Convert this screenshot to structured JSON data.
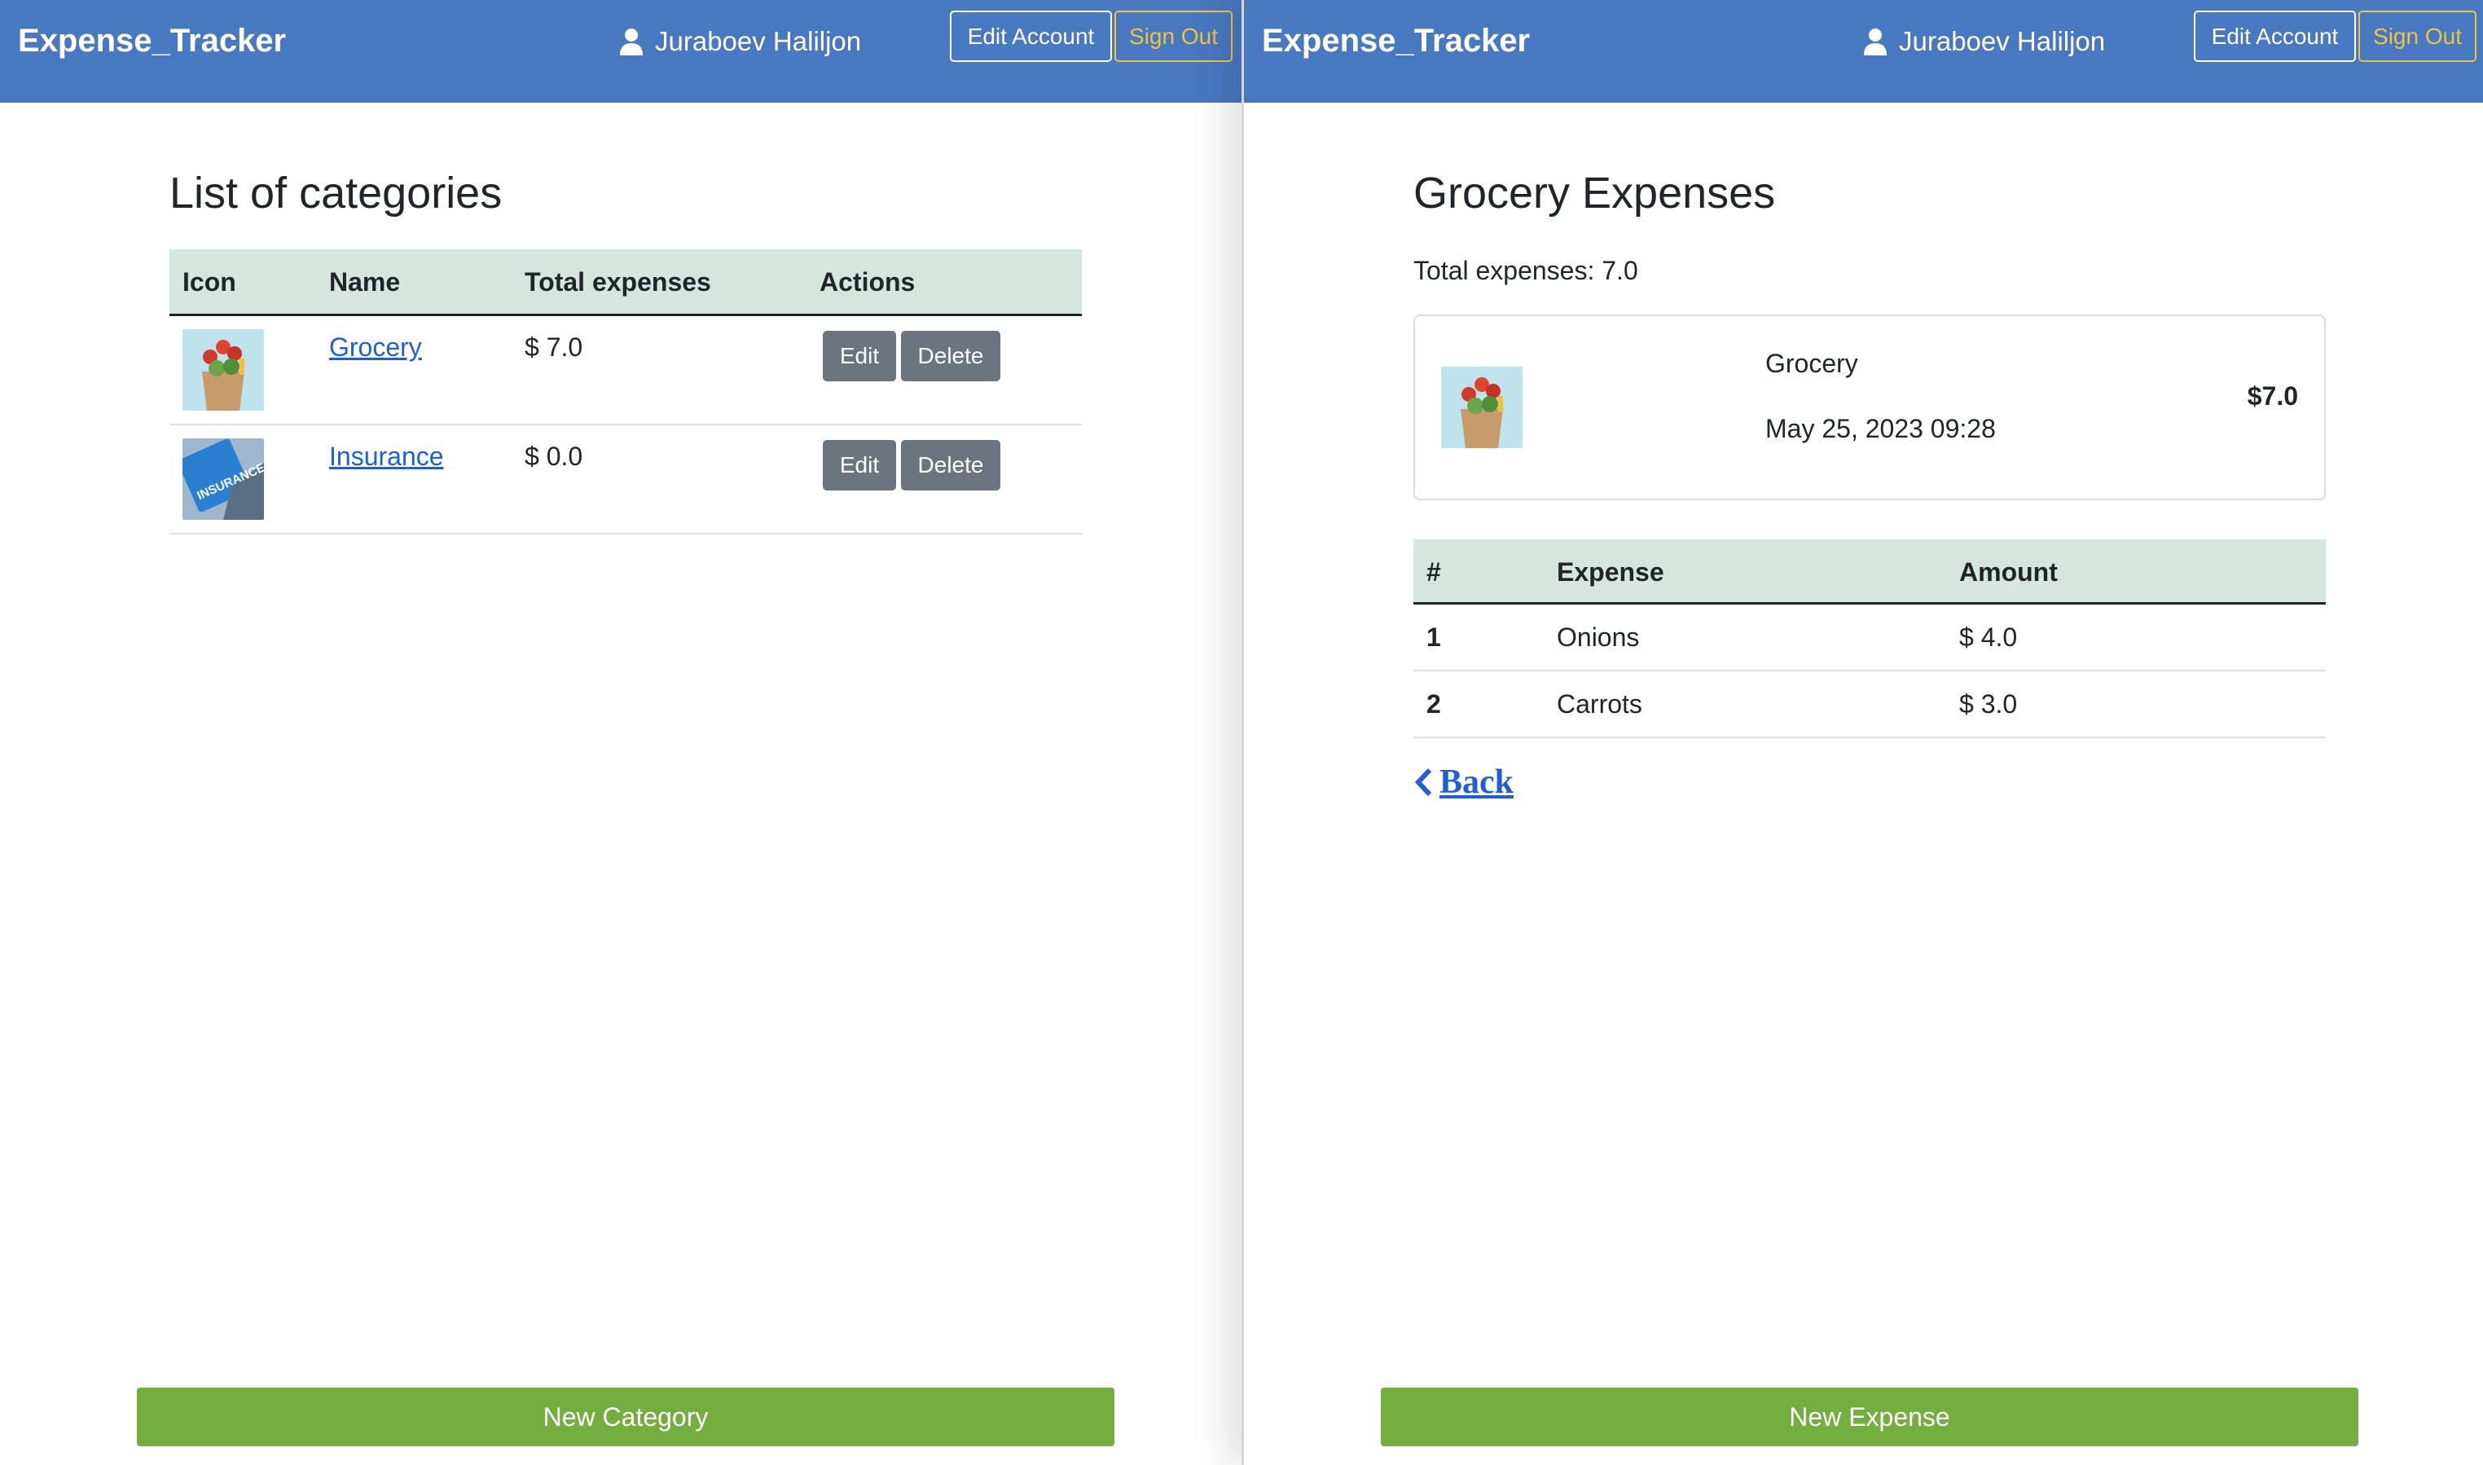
{
  "panels": [
    {
      "nav": {
        "brand": "Expense_Tracker",
        "user": "Juraboev Haliljon",
        "edit_account": "Edit Account",
        "sign_out": "Sign Out"
      }
    },
    {
      "nav": {
        "brand": "Expense_Tracker",
        "user": "Juraboev Haliljon",
        "edit_account": "Edit Account",
        "sign_out": "Sign Out"
      }
    }
  ],
  "categories_page": {
    "title": "List of categories",
    "columns": [
      "Icon",
      "Name",
      "Total expenses",
      "Actions"
    ],
    "rows": [
      {
        "icon": "grocery-bag-image",
        "name": "Grocery",
        "total": "$ 7.0",
        "edit": "Edit",
        "delete": "Delete"
      },
      {
        "icon": "insurance-sign-image",
        "name": "Insurance",
        "total": "$ 0.0",
        "edit": "Edit",
        "delete": "Delete"
      }
    ],
    "new_button": "New Category"
  },
  "expenses_page": {
    "title": "Grocery Expenses",
    "total": "Total expenses: 7.0",
    "card": {
      "icon": "grocery-bag-image",
      "name": "Grocery",
      "date": "May 25, 2023 09:28",
      "amount": "$7.0"
    },
    "columns": [
      "#",
      "Expense",
      "Amount"
    ],
    "rows": [
      {
        "num": "1",
        "expense": "Onions",
        "amount": "$ 4.0"
      },
      {
        "num": "2",
        "expense": "Carrots",
        "amount": "$ 3.0"
      }
    ],
    "back": "Back",
    "new_button": "New Expense"
  },
  "colors": {
    "navbar": "#4878bf",
    "sign_out": "#f0c240",
    "table_header": "#d5e6de",
    "action_button": "#6c757d",
    "primary_action": "#74ae3e",
    "link": "#1e5fd6"
  }
}
